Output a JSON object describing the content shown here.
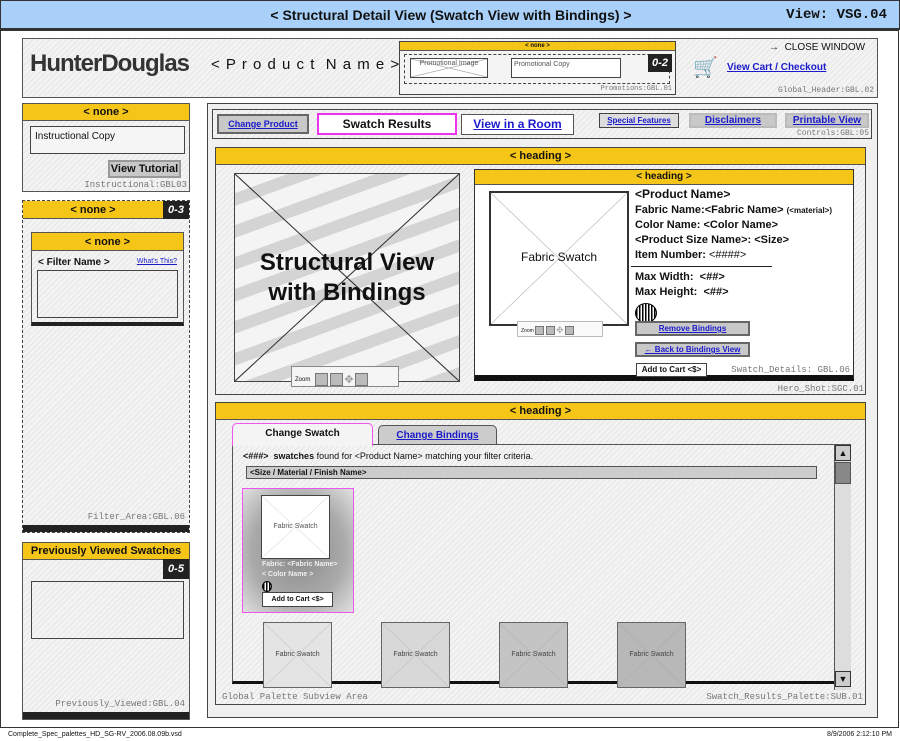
{
  "title_bar": {
    "title": "< Structural Detail View (Swatch View with Bindings) >",
    "view": "View: VSG.04"
  },
  "header": {
    "logo": "HunterDouglas",
    "product_name": "< P r o d u c t  N a m e >",
    "promo": {
      "heading": "< none >",
      "image": "Promotional Image",
      "copy": "Promotional Copy",
      "badge": "0-2",
      "label": "Promotions:GBL.01"
    },
    "close_window": "CLOSE WINDOW",
    "view_cart": "View Cart / Checkout",
    "label": "Global_Header:GBL.02"
  },
  "instructional": {
    "heading": "< none >",
    "copy": "Instructional Copy",
    "button": "View Tutorial",
    "label": "Instructional:GBL03"
  },
  "filter": {
    "heading": "< none >",
    "badge": "0-3",
    "inner_heading": "< none >",
    "filter_name": "< Filter Name >",
    "whats_this": "What's This?",
    "label": "Filter_Area:GBL.06"
  },
  "previously_viewed": {
    "heading": "Previously Viewed Swatches",
    "badge": "0-5",
    "label": "Previously_Viewed:GBL.04"
  },
  "controls": {
    "change_product": "Change Product",
    "swatch_results": "Swatch Results",
    "view_in_room": "View in a Room",
    "special_features": "Special Features",
    "disclaimers": "Disclaimers",
    "printable_view": "Printable View",
    "label": "Controls:GBL:05"
  },
  "hero": {
    "heading": "< heading >",
    "image_text": "Structural View with Bindings",
    "zoom": "Zoom",
    "label": "Hero_Shot:SGC.01",
    "details": {
      "heading": "< heading >",
      "swatch": "Fabric Swatch",
      "zoom": "Zoom",
      "product_name": "<Product Name>",
      "fabric": "Fabric Name:<Fabric Name>",
      "material": "(<material>)",
      "color": "Color Name: <Color Name>",
      "size": "<Product Size Name>: <Size>",
      "item_label": "Item Number:",
      "item_value": "<####>",
      "max_width": "Max Width:  <##>",
      "max_height": "Max Height:  <##>",
      "remove_bindings": "Remove Bindings",
      "back_bindings": "← Back to Bindings View",
      "add_to_cart": "Add to Cart <$>",
      "label": "Swatch_Details: GBL.06"
    }
  },
  "results": {
    "heading": "< heading >",
    "tabs": [
      {
        "label": "Change Swatch",
        "active": true
      },
      {
        "label": "Change Bindings",
        "active": false
      }
    ],
    "count": "<###>",
    "count_word": "swatches",
    "summary": "found for <Product Name> matching your filter criteria.",
    "group": "<Size / Material / Finish Name>",
    "selected": {
      "swatch": "Fabric Swatch",
      "fabric": "Fabric: <Fabric Name>",
      "color": "< Color Name >",
      "add_to_cart": "Add to Cart <$>"
    },
    "swatches": [
      {
        "label": "Fabric Swatch",
        "shade": "#e4e4e4"
      },
      {
        "label": "Fabric Swatch",
        "shade": "#d8d8d8"
      },
      {
        "label": "Fabric Swatch",
        "shade": "#c4c4c4"
      },
      {
        "label": "Fabric Swatch",
        "shade": "#b8b8b8"
      }
    ],
    "label_left": "Global Palette Subview Area",
    "label_right": "Swatch_Results_Palette:SUB.01"
  },
  "footer": {
    "file": "Complete_Spec_palettes_HD_SG-RV_2006.08.09b.vsd",
    "timestamp": "8/9/2006 2:12:10 PM"
  },
  "colors": {
    "heading_yellow": "#f5c518",
    "title_blue": "#a8d0f8",
    "selected_pink": "#ee55ee",
    "link_blue": "#1a1acc"
  }
}
